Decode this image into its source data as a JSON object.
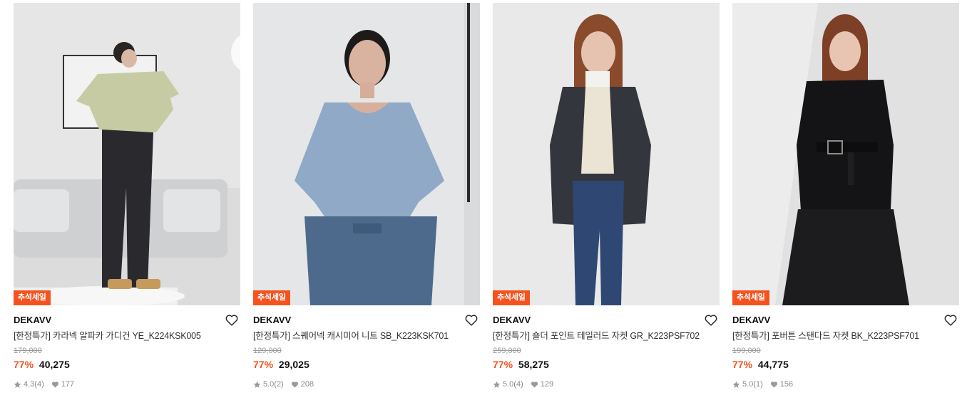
{
  "products": [
    {
      "badge": "추석세일",
      "brand": "DEKAVV",
      "title": "[한정특가] 카라넥 알파카 가디건 YE_K224KSK005",
      "original_price": "179,000",
      "discount": "77%",
      "price": "40,275",
      "rating": "4.3",
      "reviews": "(4)",
      "likes": "177",
      "bg_color": "#dedede",
      "garment_color": "#c7cba3",
      "bottom_color": "#2a2a2e"
    },
    {
      "badge": "추석세일",
      "brand": "DEKAVV",
      "title": "[한정특가] 스퀘어넥 캐시미어 니트 SB_K223KSK701",
      "original_price": "129,000",
      "discount": "77%",
      "price": "29,025",
      "rating": "5.0",
      "reviews": "(2)",
      "likes": "208",
      "bg_color": "#e4e6e8",
      "garment_color": "#8fa9c6",
      "bottom_color": "#4d6a8c"
    },
    {
      "badge": "추석세일",
      "brand": "DEKAVV",
      "title": "[한정특가] 숄더 포인트 테일러드 자켓 GR_K223PSF702",
      "original_price": "259,000",
      "discount": "77%",
      "price": "58,275",
      "rating": "5.0",
      "reviews": "(4)",
      "likes": "129",
      "bg_color": "#e9e9e9",
      "garment_color": "#34363d",
      "bottom_color": "#2f4873"
    },
    {
      "badge": "추석세일",
      "brand": "DEKAVV",
      "title": "[한정특가] 포버튼 스탠다드 자켓 BK_K223PSF701",
      "original_price": "199,000",
      "discount": "77%",
      "price": "44,775",
      "rating": "5.0",
      "reviews": "(1)",
      "likes": "156",
      "bg_color": "#e1e1e1",
      "garment_color": "#141416",
      "bottom_color": "#1c1c1e"
    }
  ]
}
